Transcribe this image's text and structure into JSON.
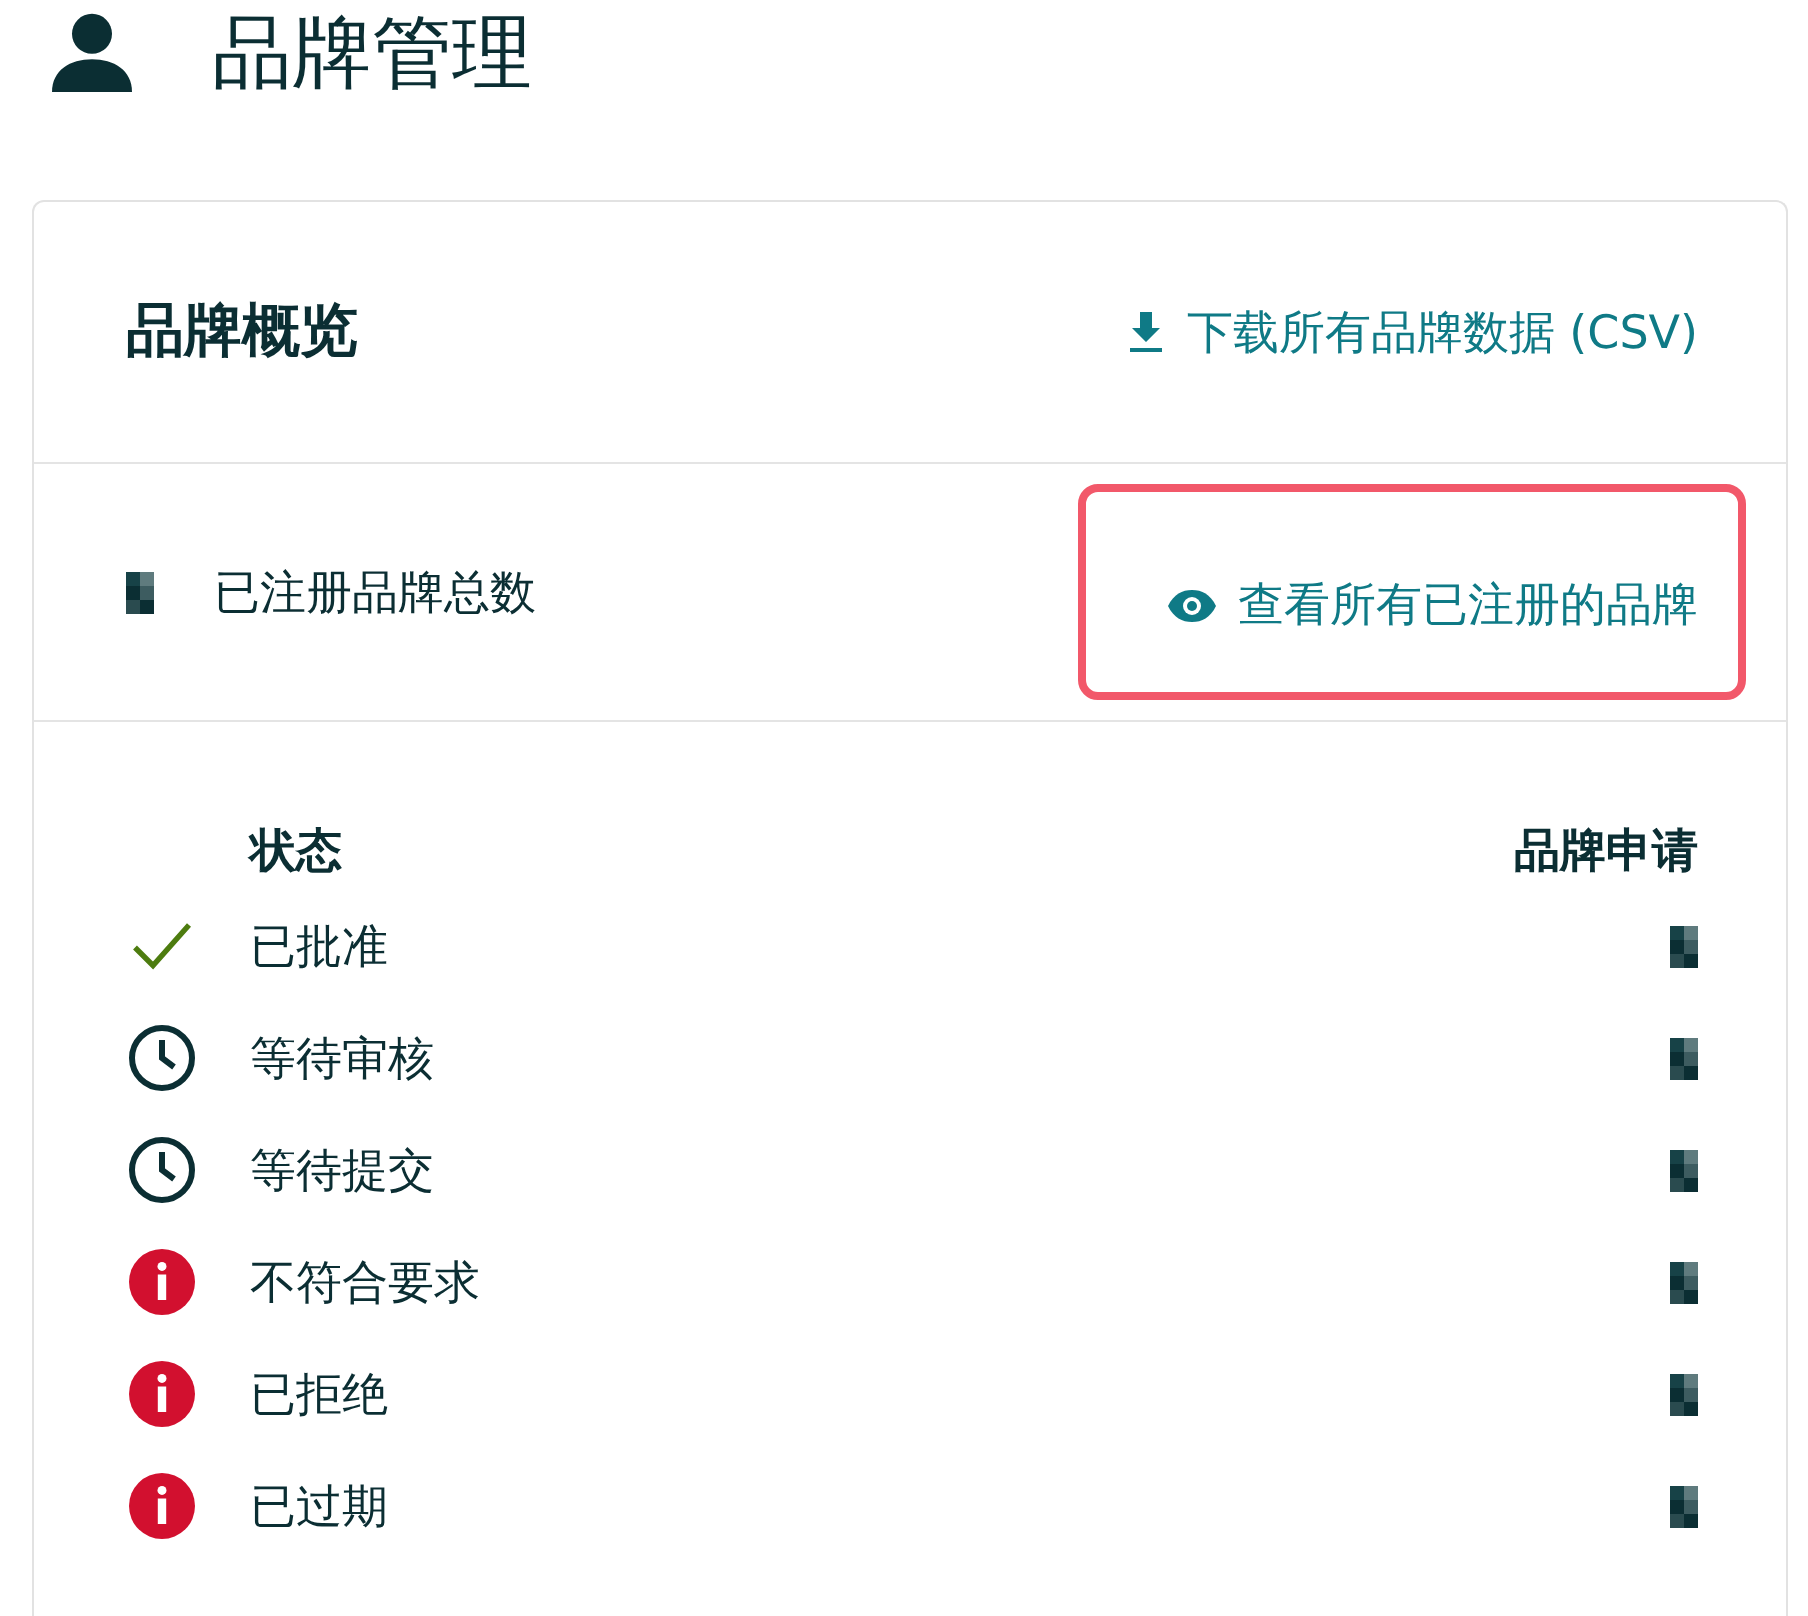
{
  "page": {
    "title": "品牌管理"
  },
  "overview": {
    "title": "品牌概览",
    "download_link": "下载所有品牌数据 (CSV)",
    "total": {
      "label": "已注册品牌总数",
      "redacted": true
    },
    "view_link": {
      "label": "查看所有已注册的品牌",
      "highlighted": true
    }
  },
  "table": {
    "columns": [
      "状态",
      "品牌申请"
    ],
    "rows": [
      {
        "kind": "approved",
        "status": "已批准",
        "redacted": true
      },
      {
        "kind": "pending",
        "status": "等待审核",
        "redacted": true
      },
      {
        "kind": "pending",
        "status": "等待提交",
        "redacted": true
      },
      {
        "kind": "alert",
        "status": "不符合要求",
        "redacted": true
      },
      {
        "kind": "alert",
        "status": "已拒绝",
        "redacted": true
      },
      {
        "kind": "alert",
        "status": "已过期",
        "redacted": true
      }
    ]
  }
}
